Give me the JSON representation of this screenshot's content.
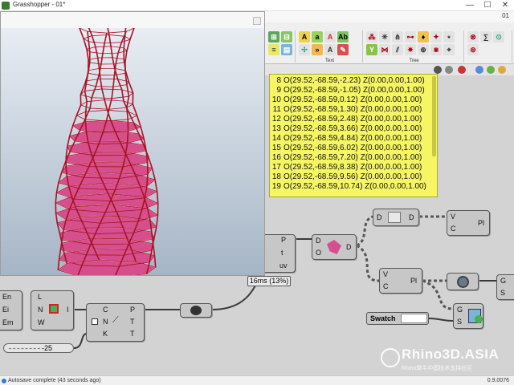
{
  "window": {
    "title": "Grasshopper - 01*",
    "document": "01",
    "min": "—",
    "max": "☐",
    "close": "✕"
  },
  "ribbon": {
    "groups": [
      {
        "label": "Text"
      },
      {
        "label": "Tree"
      }
    ]
  },
  "panel": {
    "rows": [
      {
        "idx": "8",
        "text": "O(29.52,-68.59,-2.23) Z(0.00,0.00,1.00)"
      },
      {
        "idx": "9",
        "text": "O(29.52,-68.59,-1.05) Z(0.00,0.00,1.00)"
      },
      {
        "idx": "10",
        "text": "O(29.52,-68.59,0.12) Z(0.00,0.00,1.00)"
      },
      {
        "idx": "11",
        "text": "O(29.52,-68.59,1.30) Z(0.00,0.00,1.00)"
      },
      {
        "idx": "12",
        "text": "O(29.52,-68.59,2.48) Z(0.00,0.00,1.00)"
      },
      {
        "idx": "13",
        "text": "O(29.52,-68.59,3.66) Z(0.00,0.00,1.00)"
      },
      {
        "idx": "14",
        "text": "O(29.52,-68.59,4.84) Z(0.00,0.00,1.00)"
      },
      {
        "idx": "15",
        "text": "O(29.52,-68.59,6.02) Z(0.00,0.00,1.00)"
      },
      {
        "idx": "16",
        "text": "O(29.52,-68.59,7.20) Z(0.00,0.00,1.00)"
      },
      {
        "idx": "17",
        "text": "O(29.52,-68.59,8.38) Z(0.00,0.00,1.00)"
      },
      {
        "idx": "18",
        "text": "O(29.52,-68.59,9.56) Z(0.00,0.00,1.00)"
      },
      {
        "idx": "19",
        "text": "O(29.52,-68.59,10.74) Z(0.00,0.00,1.00)"
      }
    ]
  },
  "nodes": {
    "frames": {
      "in_p": "P",
      "in_t": "t",
      "in_uv": "uv"
    },
    "explode": {
      "in_d": "D",
      "in_o": "O",
      "out": "D"
    },
    "top_node": {
      "in": "D",
      "out": "D"
    },
    "pl_top": {
      "in_v": "V",
      "in_c": "C",
      "out": "Pl"
    },
    "pl_mid": {
      "in_v": "V",
      "in_c": "C",
      "out": "Pl"
    },
    "left_frag": {
      "a": "En",
      "b": "Ei",
      "c": "Em"
    },
    "lnw": {
      "in_l": "L",
      "in_n": "N",
      "in_w": "W",
      "out": "I"
    },
    "cnk": {
      "in_c": "C",
      "in_n": "N",
      "in_k": "K",
      "out_p": "P",
      "out_t": "T",
      "out_t2": "T"
    },
    "gs": {
      "in_g": "G",
      "in_s": "S"
    },
    "right_gs": {
      "in_g": "G",
      "in_s": "S"
    }
  },
  "timer": "16ms (13%)",
  "slider": {
    "value": "25"
  },
  "swatch": {
    "label": "Swatch"
  },
  "status": {
    "message": "Autosave complete (43 seconds ago)",
    "version": "0.9.0076"
  },
  "watermark": {
    "main": "Rhino3D.ASIA",
    "sub": "Rhino犀牛中国技术支持社区"
  },
  "colors": {
    "panel": "#f6f664",
    "vase_fill": "#d64f8c",
    "vase_wire": "#a81224"
  }
}
